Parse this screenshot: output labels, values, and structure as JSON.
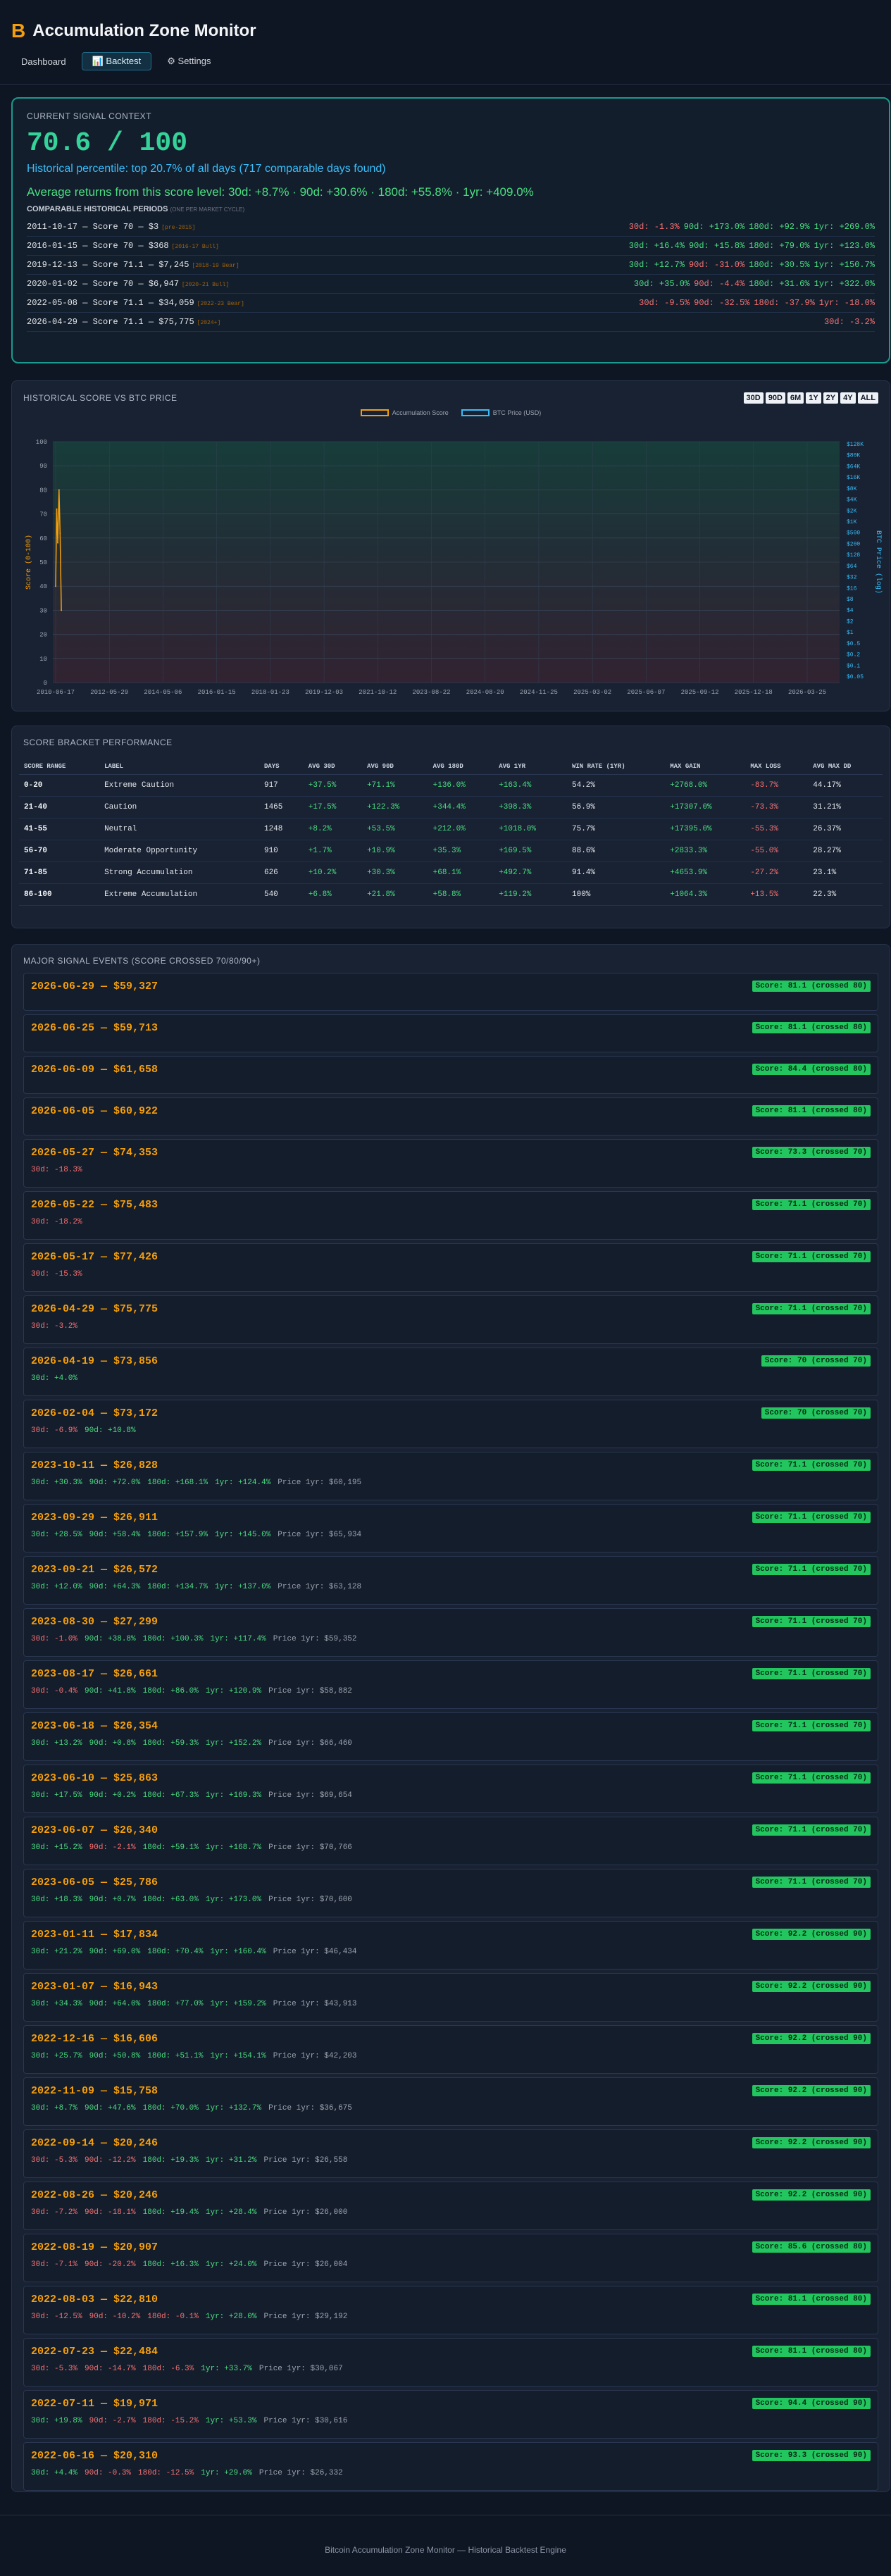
{
  "app": {
    "icon": "B",
    "title": "Accumulation Zone Monitor"
  },
  "nav": [
    {
      "label": "Dashboard",
      "active": false
    },
    {
      "label": "📊 Backtest",
      "active": true
    },
    {
      "label": "⚙ Settings",
      "active": false
    }
  ],
  "signal": {
    "label": "CURRENT SIGNAL CONTEXT",
    "score": "70.6 / 100",
    "percentile": "Historical percentile: top 20.7% of all days (717 comparable days found)",
    "avg_returns": "Average returns from this score level: 30d: +8.7% · 90d: +30.6% · 180d: +55.8% · 1yr: +409.0%",
    "periods_label": "COMPARABLE HISTORICAL PERIODS",
    "periods_note": "(ONE PER MARKET CYCLE)",
    "periods": [
      {
        "text": "2011-10-17 — Score 70 — $3",
        "tag": "[pre-2015]",
        "rets": [
          {
            "t": "30d: -1.3%",
            "c": "neg"
          },
          {
            "t": "90d: +173.0%",
            "c": "pos"
          },
          {
            "t": "180d: +92.9%",
            "c": "pos"
          },
          {
            "t": "1yr: +269.0%",
            "c": "pos"
          }
        ]
      },
      {
        "text": "2016-01-15 — Score 70 — $368",
        "tag": "[2016-17 Bull]",
        "rets": [
          {
            "t": "30d: +16.4%",
            "c": "pos"
          },
          {
            "t": "90d: +15.8%",
            "c": "pos"
          },
          {
            "t": "180d: +79.0%",
            "c": "pos"
          },
          {
            "t": "1yr: +123.0%",
            "c": "pos"
          }
        ]
      },
      {
        "text": "2019-12-13 — Score 71.1 — $7,245",
        "tag": "[2018-19 Bear]",
        "rets": [
          {
            "t": "30d: +12.7%",
            "c": "pos"
          },
          {
            "t": "90d: -31.0%",
            "c": "neg"
          },
          {
            "t": "180d: +30.5%",
            "c": "pos"
          },
          {
            "t": "1yr: +150.7%",
            "c": "pos"
          }
        ]
      },
      {
        "text": "2020-01-02 — Score 70 — $6,947",
        "tag": "[2020-21 Bull]",
        "rets": [
          {
            "t": "30d: +35.0%",
            "c": "pos"
          },
          {
            "t": "90d: -4.4%",
            "c": "neg"
          },
          {
            "t": "180d: +31.6%",
            "c": "pos"
          },
          {
            "t": "1yr: +322.0%",
            "c": "pos"
          }
        ]
      },
      {
        "text": "2022-05-08 — Score 71.1 — $34,059",
        "tag": "[2022-23 Bear]",
        "rets": [
          {
            "t": "30d: -9.5%",
            "c": "neg"
          },
          {
            "t": "90d: -32.5%",
            "c": "neg"
          },
          {
            "t": "180d: -37.9%",
            "c": "neg"
          },
          {
            "t": "1yr: -18.0%",
            "c": "neg"
          }
        ]
      },
      {
        "text": "2026-04-29 — Score 71.1 — $75,775",
        "tag": "[2024+]",
        "rets": [
          {
            "t": "30d: -3.2%",
            "c": "neg"
          }
        ]
      }
    ]
  },
  "chart": {
    "label": "HISTORICAL SCORE VS BTC PRICE",
    "ranges": [
      "30D",
      "90D",
      "6M",
      "1Y",
      "2Y",
      "4Y",
      "ALL"
    ],
    "legend": [
      "Accumulation Score",
      "BTC Price (USD)"
    ],
    "colors": {
      "score": "#f59e0b",
      "price": "#38bdf8"
    }
  },
  "chart_data": {
    "type": "line",
    "x": [
      "2010-06-17",
      "2012-05-29",
      "2014-05-06",
      "2016-01-15",
      "2018-01-23",
      "2019-12-03",
      "2021-10-12",
      "2023-08-22",
      "2024-08-20",
      "2024-11-25",
      "2025-03-02",
      "2025-06-07",
      "2025-09-12",
      "2025-12-18",
      "2026-03-25"
    ],
    "xlabel": "",
    "ylabel": "Score (0-100)",
    "ylim": [
      0,
      100
    ],
    "yticks": [
      "0",
      "10",
      "20",
      "30",
      "40",
      "50",
      "60",
      "70",
      "80",
      "90",
      "100"
    ],
    "y2label": "BTC Price (log)",
    "y2ticks": [
      "$128K",
      "$80K",
      "$64K",
      "$16K",
      "$8K",
      "$4K",
      "$2K",
      "$1K",
      "$500",
      "$200",
      "$128",
      "$64",
      "$32",
      "$16",
      "$8",
      "$4",
      "$2",
      "$1",
      "$0.5",
      "$0.2",
      "$0.1",
      "$0.05"
    ],
    "series": [
      {
        "name": "Accumulation Score",
        "values": [
          {
            "x": "2010-06-17",
            "y": 40
          },
          {
            "x": "2010-07-01",
            "y": 72
          },
          {
            "x": "2010-07-15",
            "y": 58
          },
          {
            "x": "2010-08-01",
            "y": 80
          },
          {
            "x": "2010-08-15",
            "y": 62
          },
          {
            "x": "2010-09-01",
            "y": 30
          }
        ]
      }
    ],
    "grid": true,
    "legend_position": "top-center"
  },
  "brackets": {
    "label": "SCORE BRACKET PERFORMANCE",
    "headers": [
      "SCORE RANGE",
      "LABEL",
      "DAYS",
      "AVG 30D",
      "AVG 90D",
      "AVG 180D",
      "AVG 1YR",
      "WIN RATE (1YR)",
      "MAX GAIN",
      "MAX LOSS",
      "AVG MAX DD"
    ],
    "rows": [
      [
        "0-20",
        "Extreme Caution",
        "917",
        "+37.5%",
        "+71.1%",
        "+136.0%",
        "+163.4%",
        "54.2%",
        "+2768.0%",
        "-83.7%",
        "44.17%"
      ],
      [
        "21-40",
        "Caution",
        "1465",
        "+17.5%",
        "+122.3%",
        "+344.4%",
        "+398.3%",
        "56.9%",
        "+17307.0%",
        "-73.3%",
        "31.21%"
      ],
      [
        "41-55",
        "Neutral",
        "1248",
        "+8.2%",
        "+53.5%",
        "+212.0%",
        "+1018.0%",
        "75.7%",
        "+17395.0%",
        "-55.3%",
        "26.37%"
      ],
      [
        "56-70",
        "Moderate Opportunity",
        "910",
        "+1.7%",
        "+10.9%",
        "+35.3%",
        "+169.5%",
        "88.6%",
        "+2833.3%",
        "-55.0%",
        "28.27%"
      ],
      [
        "71-85",
        "Strong Accumulation",
        "626",
        "+10.2%",
        "+30.3%",
        "+68.1%",
        "+492.7%",
        "91.4%",
        "+4653.9%",
        "-27.2%",
        "23.1%"
      ],
      [
        "86-100",
        "Extreme Accumulation",
        "540",
        "+6.8%",
        "+21.8%",
        "+58.8%",
        "+119.2%",
        "100%",
        "+1064.3%",
        "+13.5%",
        "22.3%"
      ]
    ]
  },
  "events": {
    "label": "MAJOR SIGNAL EVENTS (SCORE CROSSED 70/80/90+)",
    "items": [
      {
        "title": "2026-06-29 — $59,327",
        "badge": "Score: 81.1 (crossed 80)",
        "rets": []
      },
      {
        "title": "2026-06-25 — $59,713",
        "badge": "Score: 81.1 (crossed 80)",
        "rets": []
      },
      {
        "title": "2026-06-09 — $61,658",
        "badge": "Score: 84.4 (crossed 80)",
        "rets": []
      },
      {
        "title": "2026-06-05 — $60,922",
        "badge": "Score: 81.1 (crossed 80)",
        "rets": []
      },
      {
        "title": "2026-05-27 — $74,353",
        "badge": "Score: 73.3 (crossed 70)",
        "rets": [
          {
            "t": "30d: -18.3%",
            "c": "neg"
          }
        ]
      },
      {
        "title": "2026-05-22 — $75,483",
        "badge": "Score: 71.1 (crossed 70)",
        "rets": [
          {
            "t": "30d: -18.2%",
            "c": "neg"
          }
        ]
      },
      {
        "title": "2026-05-17 — $77,426",
        "badge": "Score: 71.1 (crossed 70)",
        "rets": [
          {
            "t": "30d: -15.3%",
            "c": "neg"
          }
        ]
      },
      {
        "title": "2026-04-29 — $75,775",
        "badge": "Score: 71.1 (crossed 70)",
        "rets": [
          {
            "t": "30d: -3.2%",
            "c": "neg"
          }
        ]
      },
      {
        "title": "2026-04-19 — $73,856",
        "badge": "Score: 70 (crossed 70)",
        "rets": [
          {
            "t": "30d: +4.0%",
            "c": "pos"
          }
        ]
      },
      {
        "title": "2026-02-04 — $73,172",
        "badge": "Score: 70 (crossed 70)",
        "rets": [
          {
            "t": "30d: -6.9%",
            "c": "neg"
          },
          {
            "t": "90d: +10.8%",
            "c": "pos"
          }
        ]
      },
      {
        "title": "2023-10-11 — $26,828",
        "badge": "Score: 71.1 (crossed 70)",
        "rets": [
          {
            "t": "30d: +30.3%",
            "c": "pos"
          },
          {
            "t": "90d: +72.0%",
            "c": "pos"
          },
          {
            "t": "180d: +168.1%",
            "c": "pos"
          },
          {
            "t": "1yr: +124.4%",
            "c": "pos"
          },
          {
            "t": "Price 1yr: $60,195",
            "c": "price1"
          }
        ]
      },
      {
        "title": "2023-09-29 — $26,911",
        "badge": "Score: 71.1 (crossed 70)",
        "rets": [
          {
            "t": "30d: +28.5%",
            "c": "pos"
          },
          {
            "t": "90d: +58.4%",
            "c": "pos"
          },
          {
            "t": "180d: +157.9%",
            "c": "pos"
          },
          {
            "t": "1yr: +145.0%",
            "c": "pos"
          },
          {
            "t": "Price 1yr: $65,934",
            "c": "price1"
          }
        ]
      },
      {
        "title": "2023-09-21 — $26,572",
        "badge": "Score: 71.1 (crossed 70)",
        "rets": [
          {
            "t": "30d: +12.0%",
            "c": "pos"
          },
          {
            "t": "90d: +64.3%",
            "c": "pos"
          },
          {
            "t": "180d: +134.7%",
            "c": "pos"
          },
          {
            "t": "1yr: +137.0%",
            "c": "pos"
          },
          {
            "t": "Price 1yr: $63,128",
            "c": "price1"
          }
        ]
      },
      {
        "title": "2023-08-30 — $27,299",
        "badge": "Score: 71.1 (crossed 70)",
        "rets": [
          {
            "t": "30d: -1.0%",
            "c": "neg"
          },
          {
            "t": "90d: +38.8%",
            "c": "pos"
          },
          {
            "t": "180d: +100.3%",
            "c": "pos"
          },
          {
            "t": "1yr: +117.4%",
            "c": "pos"
          },
          {
            "t": "Price 1yr: $59,352",
            "c": "price1"
          }
        ]
      },
      {
        "title": "2023-08-17 — $26,661",
        "badge": "Score: 71.1 (crossed 70)",
        "rets": [
          {
            "t": "30d: -0.4%",
            "c": "neg"
          },
          {
            "t": "90d: +41.8%",
            "c": "pos"
          },
          {
            "t": "180d: +86.0%",
            "c": "pos"
          },
          {
            "t": "1yr: +120.9%",
            "c": "pos"
          },
          {
            "t": "Price 1yr: $58,882",
            "c": "price1"
          }
        ]
      },
      {
        "title": "2023-06-18 — $26,354",
        "badge": "Score: 71.1 (crossed 70)",
        "rets": [
          {
            "t": "30d: +13.2%",
            "c": "pos"
          },
          {
            "t": "90d: +0.8%",
            "c": "pos"
          },
          {
            "t": "180d: +59.3%",
            "c": "pos"
          },
          {
            "t": "1yr: +152.2%",
            "c": "pos"
          },
          {
            "t": "Price 1yr: $66,460",
            "c": "price1"
          }
        ]
      },
      {
        "title": "2023-06-10 — $25,863",
        "badge": "Score: 71.1 (crossed 70)",
        "rets": [
          {
            "t": "30d: +17.5%",
            "c": "pos"
          },
          {
            "t": "90d: +0.2%",
            "c": "pos"
          },
          {
            "t": "180d: +67.3%",
            "c": "pos"
          },
          {
            "t": "1yr: +169.3%",
            "c": "pos"
          },
          {
            "t": "Price 1yr: $69,654",
            "c": "price1"
          }
        ]
      },
      {
        "title": "2023-06-07 — $26,340",
        "badge": "Score: 71.1 (crossed 70)",
        "rets": [
          {
            "t": "30d: +15.2%",
            "c": "pos"
          },
          {
            "t": "90d: -2.1%",
            "c": "neg"
          },
          {
            "t": "180d: +59.1%",
            "c": "pos"
          },
          {
            "t": "1yr: +168.7%",
            "c": "pos"
          },
          {
            "t": "Price 1yr: $70,766",
            "c": "price1"
          }
        ]
      },
      {
        "title": "2023-06-05 — $25,786",
        "badge": "Score: 71.1 (crossed 70)",
        "rets": [
          {
            "t": "30d: +18.3%",
            "c": "pos"
          },
          {
            "t": "90d: +0.7%",
            "c": "pos"
          },
          {
            "t": "180d: +63.0%",
            "c": "pos"
          },
          {
            "t": "1yr: +173.0%",
            "c": "pos"
          },
          {
            "t": "Price 1yr: $70,600",
            "c": "price1"
          }
        ]
      },
      {
        "title": "2023-01-11 — $17,834",
        "badge": "Score: 92.2 (crossed 90)",
        "rets": [
          {
            "t": "30d: +21.2%",
            "c": "pos"
          },
          {
            "t": "90d: +69.0%",
            "c": "pos"
          },
          {
            "t": "180d: +70.4%",
            "c": "pos"
          },
          {
            "t": "1yr: +160.4%",
            "c": "pos"
          },
          {
            "t": "Price 1yr: $46,434",
            "c": "price1"
          }
        ]
      },
      {
        "title": "2023-01-07 — $16,943",
        "badge": "Score: 92.2 (crossed 90)",
        "rets": [
          {
            "t": "30d: +34.3%",
            "c": "pos"
          },
          {
            "t": "90d: +64.0%",
            "c": "pos"
          },
          {
            "t": "180d: +77.0%",
            "c": "pos"
          },
          {
            "t": "1yr: +159.2%",
            "c": "pos"
          },
          {
            "t": "Price 1yr: $43,913",
            "c": "price1"
          }
        ]
      },
      {
        "title": "2022-12-16 — $16,606",
        "badge": "Score: 92.2 (crossed 90)",
        "rets": [
          {
            "t": "30d: +25.7%",
            "c": "pos"
          },
          {
            "t": "90d: +50.8%",
            "c": "pos"
          },
          {
            "t": "180d: +51.1%",
            "c": "pos"
          },
          {
            "t": "1yr: +154.1%",
            "c": "pos"
          },
          {
            "t": "Price 1yr: $42,203",
            "c": "price1"
          }
        ]
      },
      {
        "title": "2022-11-09 — $15,758",
        "badge": "Score: 92.2 (crossed 90)",
        "rets": [
          {
            "t": "30d: +8.7%",
            "c": "pos"
          },
          {
            "t": "90d: +47.6%",
            "c": "pos"
          },
          {
            "t": "180d: +70.0%",
            "c": "pos"
          },
          {
            "t": "1yr: +132.7%",
            "c": "pos"
          },
          {
            "t": "Price 1yr: $36,675",
            "c": "price1"
          }
        ]
      },
      {
        "title": "2022-09-14 — $20,246",
        "badge": "Score: 92.2 (crossed 90)",
        "rets": [
          {
            "t": "30d: -5.3%",
            "c": "neg"
          },
          {
            "t": "90d: -12.2%",
            "c": "neg"
          },
          {
            "t": "180d: +19.3%",
            "c": "pos"
          },
          {
            "t": "1yr: +31.2%",
            "c": "pos"
          },
          {
            "t": "Price 1yr: $26,558",
            "c": "price1"
          }
        ]
      },
      {
        "title": "2022-08-26 — $20,246",
        "badge": "Score: 92.2 (crossed 90)",
        "rets": [
          {
            "t": "30d: -7.2%",
            "c": "neg"
          },
          {
            "t": "90d: -18.1%",
            "c": "neg"
          },
          {
            "t": "180d: +19.4%",
            "c": "pos"
          },
          {
            "t": "1yr: +28.4%",
            "c": "pos"
          },
          {
            "t": "Price 1yr: $26,000",
            "c": "price1"
          }
        ]
      },
      {
        "title": "2022-08-19 — $20,907",
        "badge": "Score: 85.6 (crossed 80)",
        "rets": [
          {
            "t": "30d: -7.1%",
            "c": "neg"
          },
          {
            "t": "90d: -20.2%",
            "c": "neg"
          },
          {
            "t": "180d: +16.3%",
            "c": "pos"
          },
          {
            "t": "1yr: +24.0%",
            "c": "pos"
          },
          {
            "t": "Price 1yr: $26,004",
            "c": "price1"
          }
        ]
      },
      {
        "title": "2022-08-03 — $22,810",
        "badge": "Score: 81.1 (crossed 80)",
        "rets": [
          {
            "t": "30d: -12.5%",
            "c": "neg"
          },
          {
            "t": "90d: -10.2%",
            "c": "neg"
          },
          {
            "t": "180d: -0.1%",
            "c": "neg"
          },
          {
            "t": "1yr: +28.0%",
            "c": "pos"
          },
          {
            "t": "Price 1yr: $29,192",
            "c": "price1"
          }
        ]
      },
      {
        "title": "2022-07-23 — $22,484",
        "badge": "Score: 81.1 (crossed 80)",
        "rets": [
          {
            "t": "30d: -5.3%",
            "c": "neg"
          },
          {
            "t": "90d: -14.7%",
            "c": "neg"
          },
          {
            "t": "180d: -6.3%",
            "c": "neg"
          },
          {
            "t": "1yr: +33.7%",
            "c": "pos"
          },
          {
            "t": "Price 1yr: $30,067",
            "c": "price1"
          }
        ]
      },
      {
        "title": "2022-07-11 — $19,971",
        "badge": "Score: 94.4 (crossed 90)",
        "rets": [
          {
            "t": "30d: +19.8%",
            "c": "pos"
          },
          {
            "t": "90d: -2.7%",
            "c": "neg"
          },
          {
            "t": "180d: -15.2%",
            "c": "neg"
          },
          {
            "t": "1yr: +53.3%",
            "c": "pos"
          },
          {
            "t": "Price 1yr: $30,616",
            "c": "price1"
          }
        ]
      },
      {
        "title": "2022-06-16 — $20,310",
        "badge": "Score: 93.3 (crossed 90)",
        "rets": [
          {
            "t": "30d: +4.4%",
            "c": "pos"
          },
          {
            "t": "90d: -0.3%",
            "c": "neg"
          },
          {
            "t": "180d: -12.5%",
            "c": "neg"
          },
          {
            "t": "1yr: +29.0%",
            "c": "pos"
          },
          {
            "t": "Price 1yr: $26,332",
            "c": "price1"
          }
        ]
      }
    ]
  },
  "footer": "Bitcoin Accumulation Zone Monitor — Historical Backtest Engine"
}
